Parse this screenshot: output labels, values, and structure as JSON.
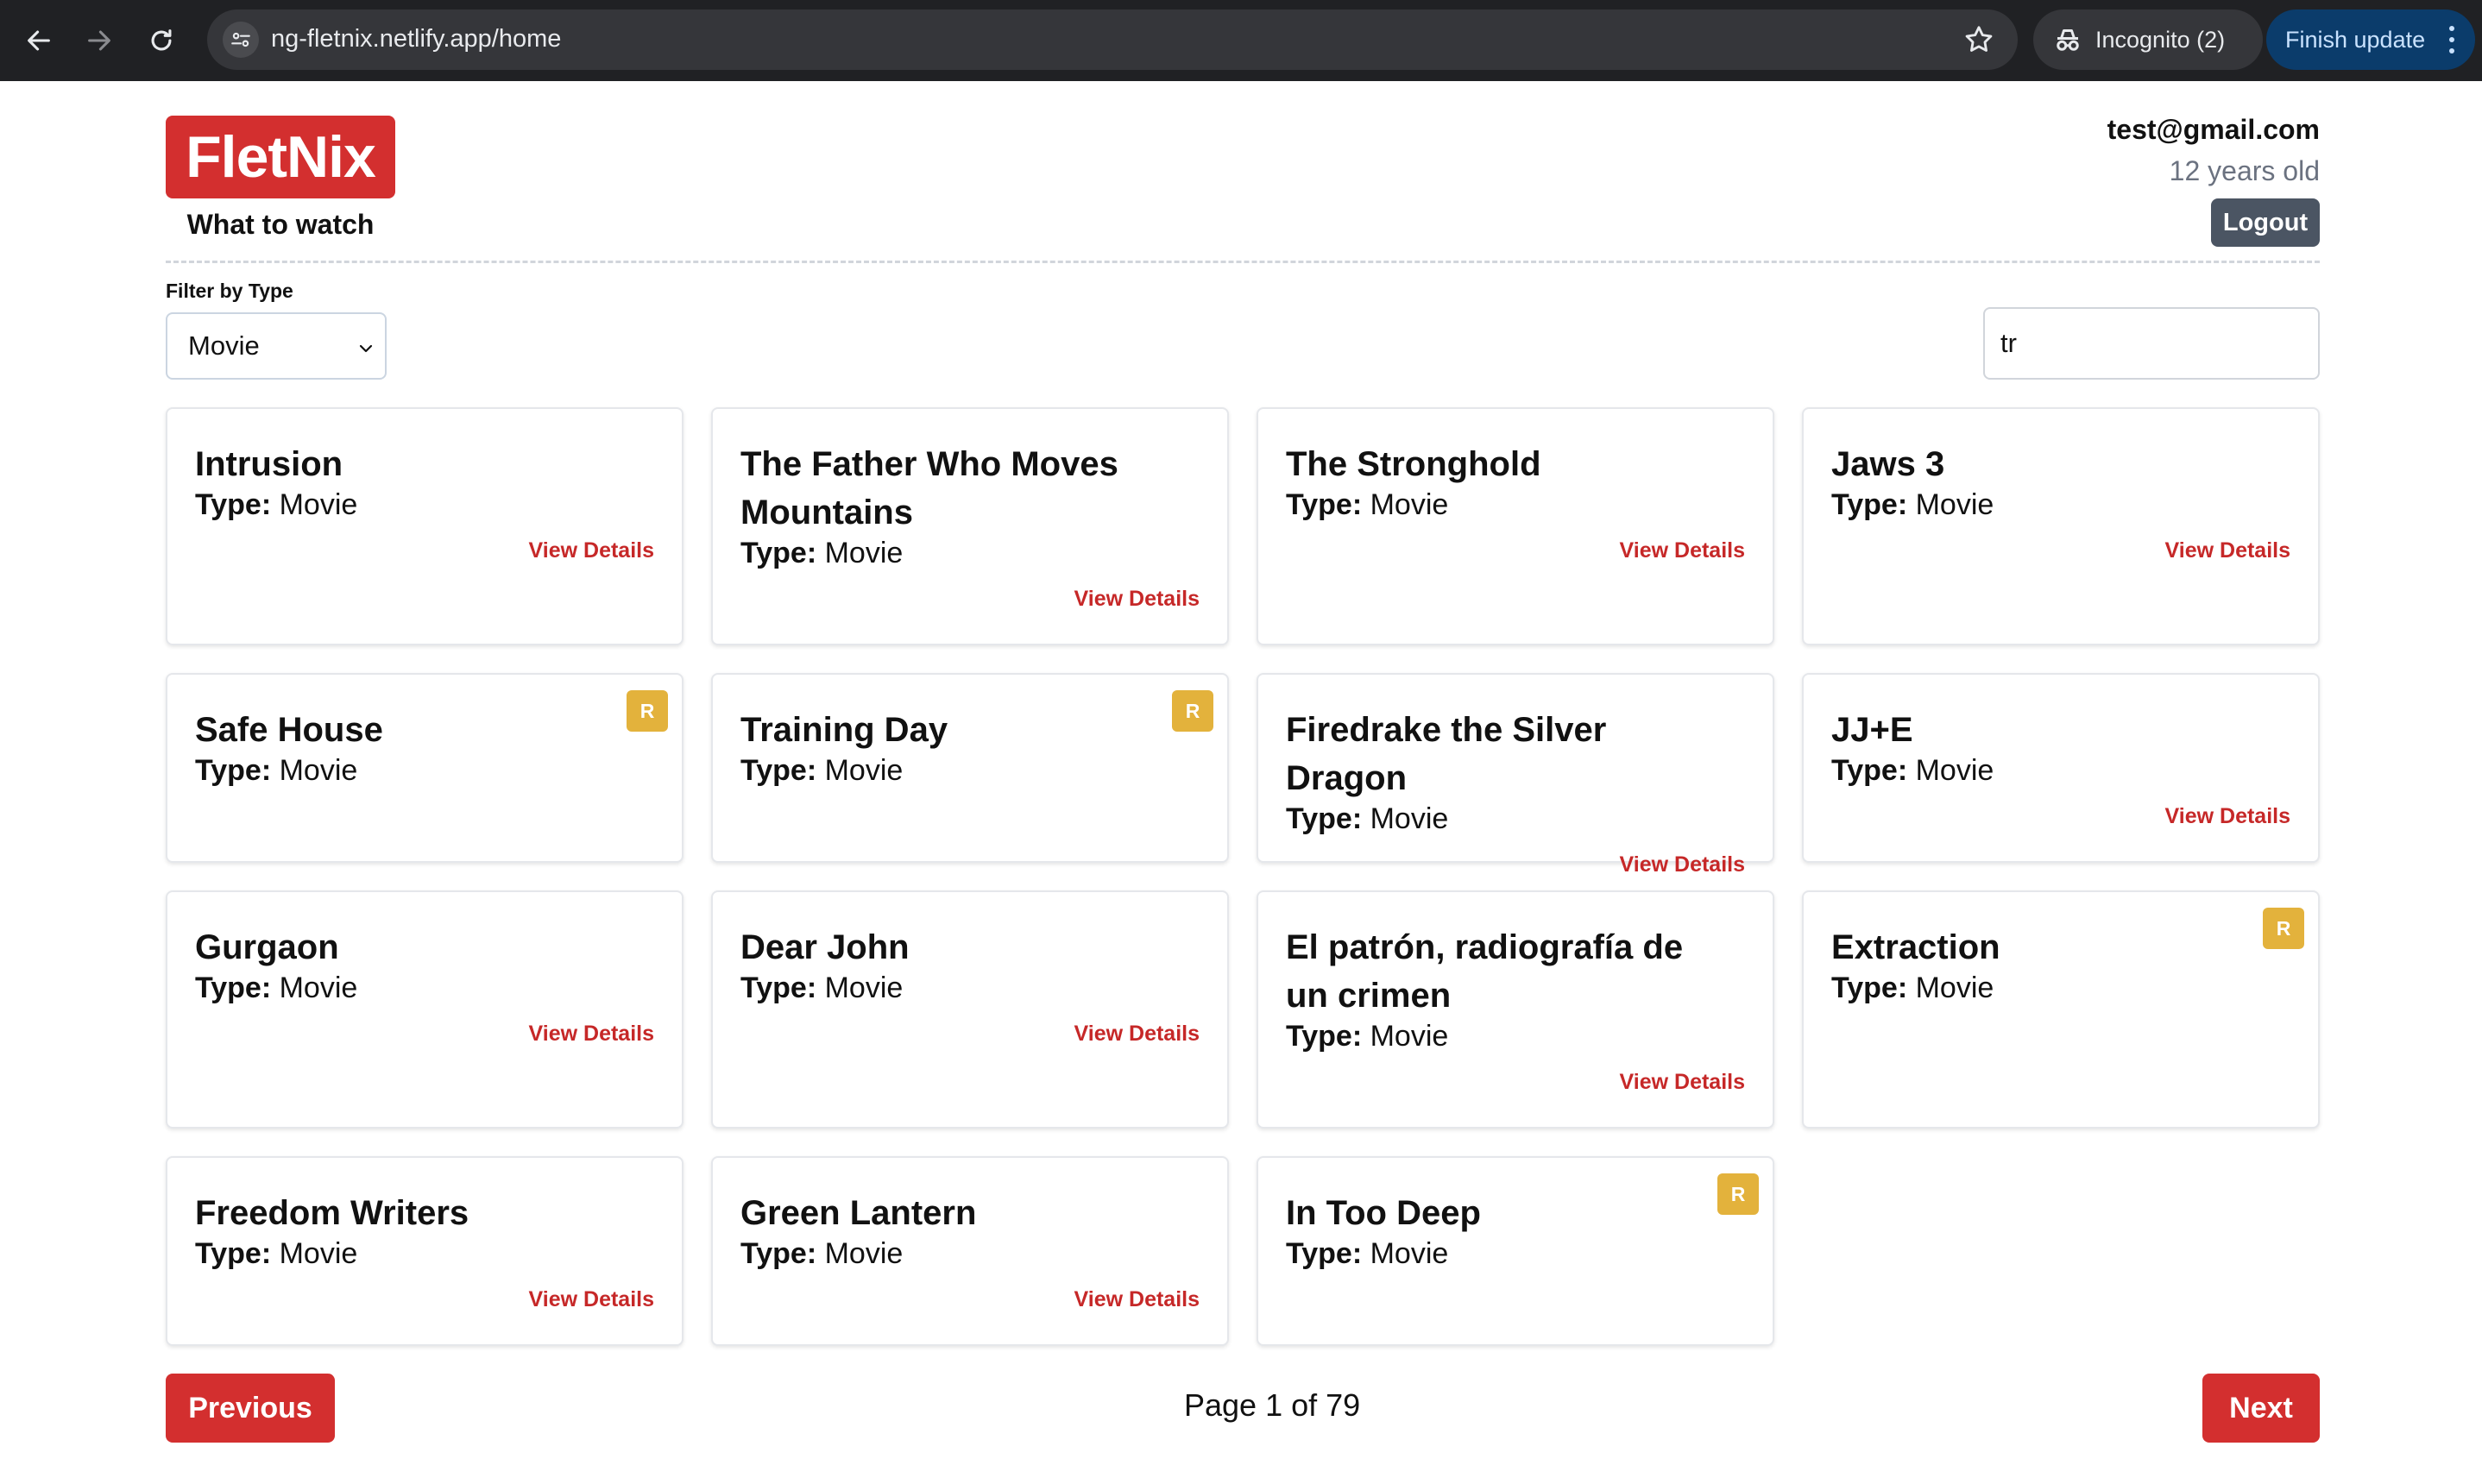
{
  "browser": {
    "url": "ng-fletnix.netlify.app/home",
    "incognito_label": "Incognito (2)",
    "update_label": "Finish update"
  },
  "header": {
    "logo": "FletNix",
    "tagline": "What to watch",
    "user_email": "test@gmail.com",
    "user_age": "12 years old",
    "logout_label": "Logout"
  },
  "filters": {
    "type_label": "Filter by Type",
    "type_selected": "Movie",
    "search_value": "tr"
  },
  "type_label": "Type:",
  "view_details_label": "View Details",
  "rating_badge": "R",
  "cards": [
    {
      "title": "Intrusion",
      "type": "Movie",
      "rated_r": false
    },
    {
      "title": "The Father Who Moves Mountains",
      "type": "Movie",
      "rated_r": false
    },
    {
      "title": "The Stronghold",
      "type": "Movie",
      "rated_r": false
    },
    {
      "title": "Jaws 3",
      "type": "Movie",
      "rated_r": false
    },
    {
      "title": "Safe House",
      "type": "Movie",
      "rated_r": true
    },
    {
      "title": "Training Day",
      "type": "Movie",
      "rated_r": true
    },
    {
      "title": "Firedrake the Silver Dragon",
      "type": "Movie",
      "rated_r": false
    },
    {
      "title": "JJ+E",
      "type": "Movie",
      "rated_r": false
    },
    {
      "title": "Gurgaon",
      "type": "Movie",
      "rated_r": false
    },
    {
      "title": "Dear John",
      "type": "Movie",
      "rated_r": false
    },
    {
      "title": "El patrón, radiografía de un crimen",
      "type": "Movie",
      "rated_r": false
    },
    {
      "title": "Extraction",
      "type": "Movie",
      "rated_r": true
    },
    {
      "title": "Freedom Writers",
      "type": "Movie",
      "rated_r": false
    },
    {
      "title": "Green Lantern",
      "type": "Movie",
      "rated_r": false
    },
    {
      "title": "In Too Deep",
      "type": "Movie",
      "rated_r": true
    }
  ],
  "pagination": {
    "previous_label": "Previous",
    "next_label": "Next",
    "page_info": "Page 1 of 79"
  },
  "colors": {
    "brand": "#d32f2f",
    "badge": "#e3b23c",
    "logout": "#4b5563"
  }
}
